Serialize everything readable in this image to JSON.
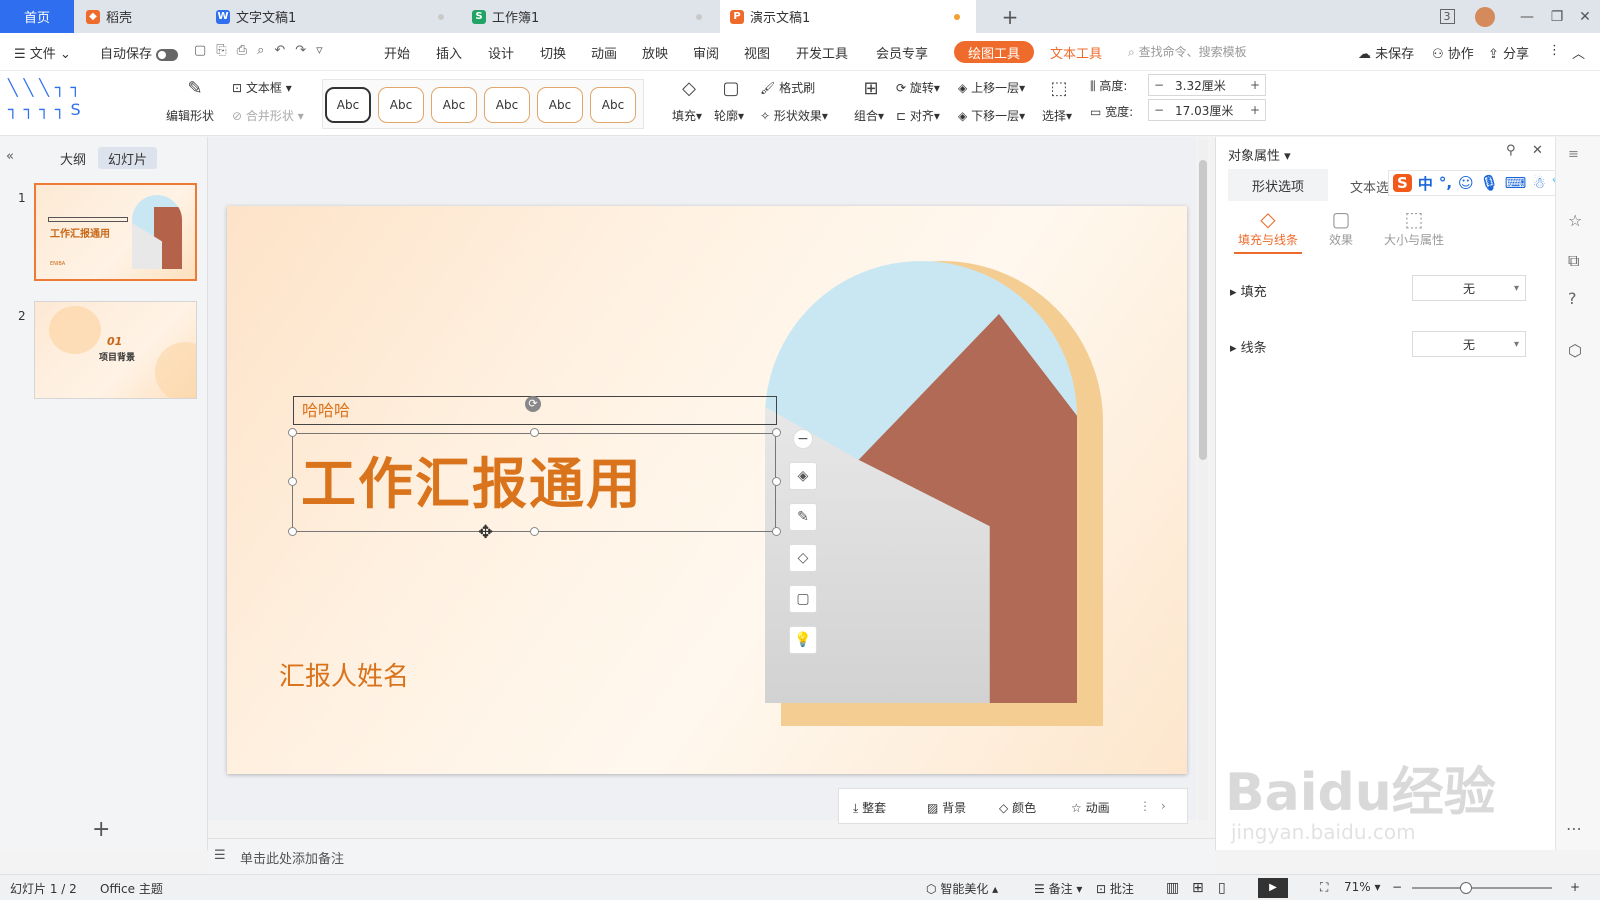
{
  "tabs": {
    "home": "首页",
    "items": [
      {
        "label": "稻壳",
        "color": "#ef6b2b",
        "icon": "daoke-icon"
      },
      {
        "label": "文字文稿1",
        "color": "#2f6fef",
        "icon": "W"
      },
      {
        "label": "工作簿1",
        "color": "#21a366",
        "icon": "S"
      },
      {
        "label": "演示文稿1",
        "color": "#ef6b2b",
        "icon": "P"
      }
    ],
    "add": "+",
    "window_count": "3"
  },
  "menu": {
    "file": "文件",
    "autosave": "自动保存",
    "items": [
      "开始",
      "插入",
      "设计",
      "切换",
      "动画",
      "放映",
      "审阅",
      "视图",
      "开发工具",
      "会员专享"
    ],
    "draw_tools": "绘图工具",
    "text_tools": "文本工具",
    "search_placeholder": "查找命令、搜索模板",
    "unsaved": "未保存",
    "collab": "协作",
    "share": "分享"
  },
  "ribbon": {
    "edit_shape": "编辑形状",
    "textbox": "文本框",
    "merge_shape": "合并形状",
    "style_samples": [
      "Abc",
      "Abc",
      "Abc",
      "Abc",
      "Abc",
      "Abc"
    ],
    "fill": "填充",
    "outline": "轮廓",
    "format_painter": "格式刷",
    "shape_effect": "形状效果",
    "group": "组合",
    "rotate": "旋转",
    "align": "对齐",
    "bring_forward": "上移一层",
    "send_backward": "下移一层",
    "select": "选择",
    "height_label": "高度:",
    "height_value": "3.32厘米",
    "width_label": "宽度:",
    "width_value": "17.03厘米"
  },
  "left_panel": {
    "outline_tab": "大纲",
    "slides_tab": "幻灯片",
    "slides": [
      {
        "num": "1",
        "title": "工作汇报通用",
        "footer": "ENIBA"
      },
      {
        "num": "2",
        "number": "01",
        "title": "项目背景"
      }
    ],
    "add": "+"
  },
  "slide": {
    "subtitle_box": "哈哈哈",
    "title": "工作汇报通用",
    "reporter": "汇报人姓名",
    "accent": "#d9731c"
  },
  "right_panel": {
    "title": "对象属性",
    "tabs": [
      "形状选项",
      "文本选项"
    ],
    "subtabs": [
      "填充与线条",
      "效果",
      "大小与属性"
    ],
    "fill_label": "填充",
    "fill_value": "无",
    "line_label": "线条",
    "line_value": "无"
  },
  "ime": {
    "s": "S",
    "lang": "中",
    "punct": "°,"
  },
  "bottom_toolbar": [
    "整套",
    "背景",
    "颜色",
    "动画"
  ],
  "notes": "单击此处添加备注",
  "status": {
    "slide_info": "幻灯片 1 / 2",
    "theme": "Office 主题",
    "beautify": "智能美化",
    "notes": "备注",
    "comments": "批注",
    "zoom": "71%"
  },
  "watermark": {
    "main": "Baidu经验",
    "sub": "jingyan.baidu.com"
  }
}
